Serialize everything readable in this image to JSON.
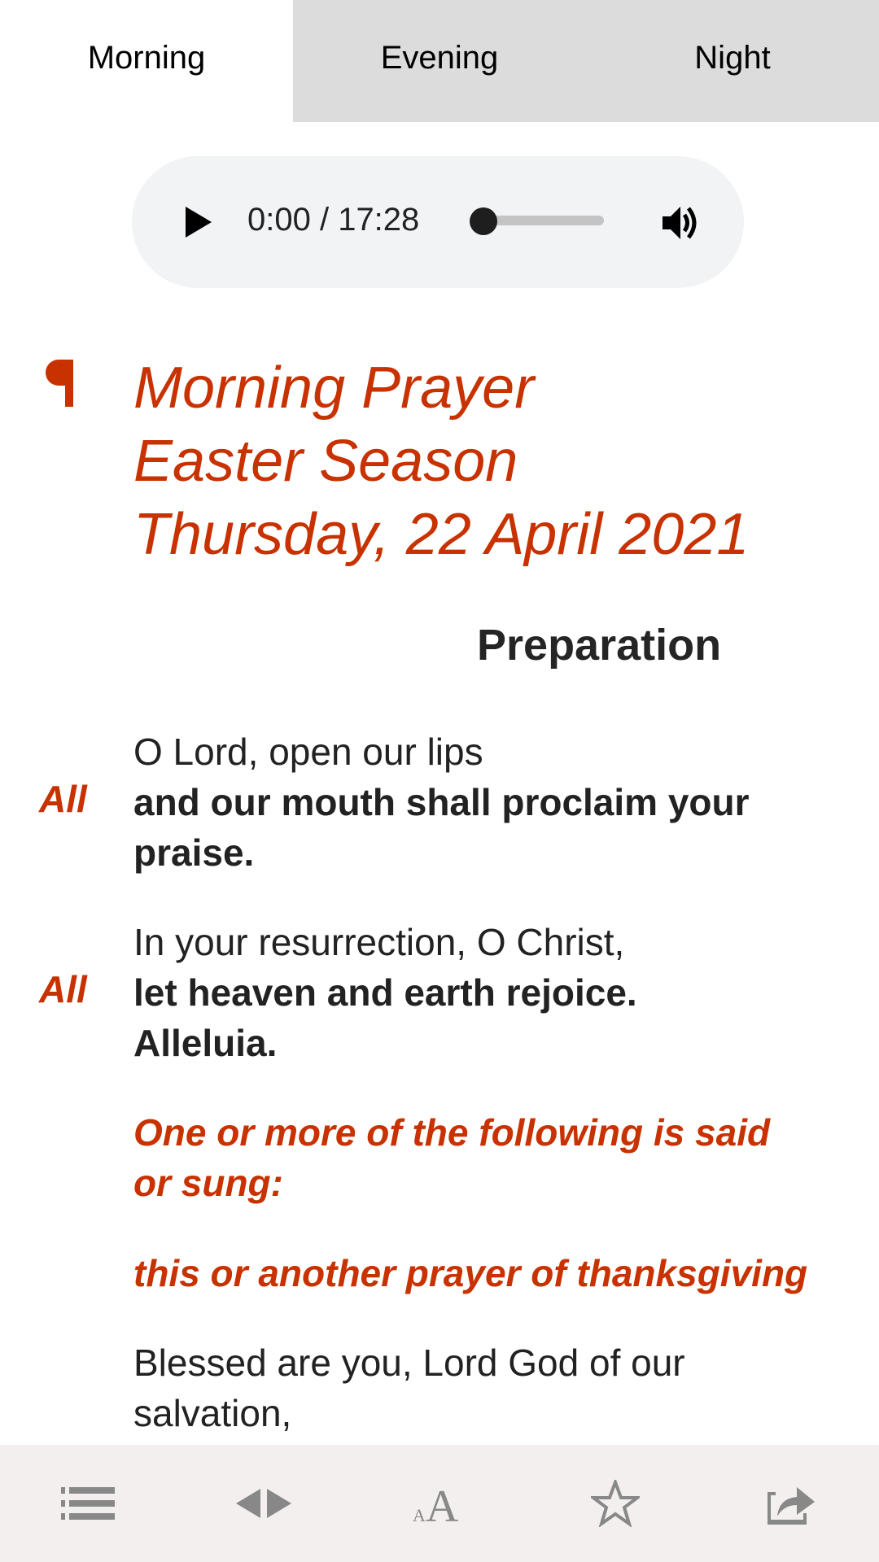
{
  "tabs": [
    {
      "label": "Morning",
      "active": true
    },
    {
      "label": "Evening",
      "active": false
    },
    {
      "label": "Night",
      "active": false
    }
  ],
  "audio_player": {
    "current_time": "0:00",
    "duration": "17:28",
    "time_display": "0:00 / 17:28",
    "progress_fraction": 0.0,
    "play_icon": "play-icon",
    "volume_icon": "volume-icon"
  },
  "office": {
    "marker_icon": "pilcrow-icon",
    "title_lines": [
      "Morning Prayer",
      "Easter Season",
      "Thursday, 22 April 2021"
    ]
  },
  "section": {
    "heading": "Preparation"
  },
  "responses": [
    {
      "leader": "O Lord, open our lips",
      "all_label": "All",
      "response_lines": [
        "and our mouth shall proclaim your",
        "praise."
      ]
    },
    {
      "leader": "In your resurrection, O Christ,",
      "all_label": "All",
      "response_lines": [
        "let heaven and earth rejoice.",
        "Alleluia."
      ]
    }
  ],
  "rubrics": {
    "instruction_lines": [
      "One or more of the following is said",
      "or sung:"
    ],
    "subheading": "this or another prayer of thanksgiving"
  },
  "body_text_lines": [
    "Blessed are you, Lord God of our",
    "salvation,"
  ],
  "bottom_nav": [
    {
      "name": "contents",
      "icon": "list-icon"
    },
    {
      "name": "previous-next",
      "icon": "left-right-arrows-icon"
    },
    {
      "name": "text-size",
      "icon": "font-size-icon"
    },
    {
      "name": "bookmark",
      "icon": "star-icon"
    },
    {
      "name": "share",
      "icon": "share-icon"
    }
  ],
  "colors": {
    "accent_red": "#c83200",
    "tab_inactive_bg": "#dcdcdc",
    "player_bg": "#f1f3f4",
    "bottom_bar_bg": "#f3efef",
    "icon_gray": "#888888"
  }
}
